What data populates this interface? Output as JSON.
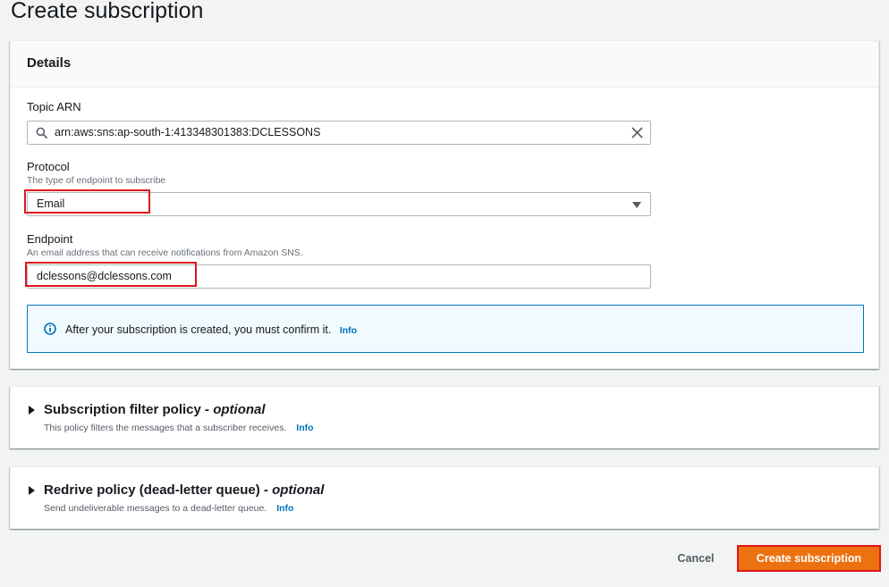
{
  "page": {
    "title": "Create subscription"
  },
  "details": {
    "header": "Details",
    "topic_arn": {
      "label": "Topic ARN",
      "value": "arn:aws:sns:ap-south-1:413348301383:DCLESSONS"
    },
    "protocol": {
      "label": "Protocol",
      "description": "The type of endpoint to subscribe",
      "value": "Email"
    },
    "endpoint": {
      "label": "Endpoint",
      "description": "An email address that can receive notifications from Amazon SNS.",
      "value": "dclessons@dclessons.com"
    },
    "alert": {
      "message": "After your subscription is created, you must confirm it.",
      "link": "Info"
    }
  },
  "filter_policy": {
    "title": "Subscription filter policy",
    "optional": "optional",
    "separator": " - ",
    "description": "This policy filters the messages that a subscriber receives.",
    "link": "Info"
  },
  "redrive_policy": {
    "title": "Redrive policy (dead-letter queue)",
    "optional": "optional",
    "separator": " - ",
    "description": "Send undeliverable messages to a dead-letter queue.",
    "link": "Info"
  },
  "footer": {
    "cancel_label": "Cancel",
    "create_label": "Create subscription"
  },
  "colors": {
    "primary": "#ec7211",
    "link": "#0073bb",
    "highlight": "#e0161b",
    "alert_bg": "#f1faff"
  },
  "icons": {
    "search": "search-icon",
    "clear": "close-icon",
    "dropdown": "caret-down-icon",
    "info": "info-icon",
    "expand": "caret-right-icon"
  }
}
